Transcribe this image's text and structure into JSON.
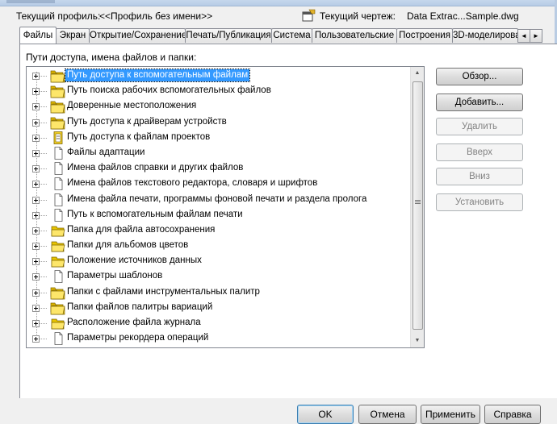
{
  "header": {
    "profile_label": "Текущий профиль:",
    "profile_value": "<<Профиль без имени>>",
    "drawing_label": "Текущий чертеж:",
    "drawing_value": "Data Extrac...Sample.dwg"
  },
  "tabs": [
    {
      "label": "Файлы",
      "active": true
    },
    {
      "label": "Экран"
    },
    {
      "label": "Открытие/Сохранение"
    },
    {
      "label": "Печать/Публикация"
    },
    {
      "label": "Система"
    },
    {
      "label": "Пользовательские"
    },
    {
      "label": "Построения"
    },
    {
      "label": "3D-моделирова"
    }
  ],
  "tab_scroll": {
    "left": "◄",
    "right": "►"
  },
  "paths_label": "Пути доступа, имена файлов и папки:",
  "tree": [
    {
      "label": "Путь доступа к вспомогательным файлам",
      "icon": "folder-stack-icon",
      "selected": true
    },
    {
      "label": "Путь поиска рабочих вспомогательных файлов",
      "icon": "folder-stack-icon"
    },
    {
      "label": "Доверенные местоположения",
      "icon": "folder-stack-icon"
    },
    {
      "label": "Путь доступа к драйверам устройств",
      "icon": "folder-stack-icon"
    },
    {
      "label": "Путь доступа к файлам проектов",
      "icon": "project-file-icon"
    },
    {
      "label": "Файлы адаптации",
      "icon": "file-icon"
    },
    {
      "label": "Имена файлов справки и других файлов",
      "icon": "file-icon"
    },
    {
      "label": "Имена файлов текстового редактора, словаря и шрифтов",
      "icon": "file-icon"
    },
    {
      "label": "Имена файла печати, программы фоновой печати и раздела пролога",
      "icon": "file-icon"
    },
    {
      "label": "Путь к вспомогательным файлам печати",
      "icon": "file-icon"
    },
    {
      "label": "Папка для файла автосохранения",
      "icon": "folder-icon"
    },
    {
      "label": "Папки для альбомов цветов",
      "icon": "folder-icon"
    },
    {
      "label": "Положение источников данных",
      "icon": "folder-icon"
    },
    {
      "label": "Параметры шаблонов",
      "icon": "file-icon"
    },
    {
      "label": "Папки с файлами инструментальных палитр",
      "icon": "folder-stack-icon"
    },
    {
      "label": "Папки файлов палитры вариаций",
      "icon": "folder-stack-icon"
    },
    {
      "label": "Расположение файла журнала",
      "icon": "folder-icon"
    },
    {
      "label": "Параметры рекордера операций",
      "icon": "file-icon"
    }
  ],
  "side_buttons": [
    {
      "label": "Обзор...",
      "enabled": true
    },
    {
      "label": "Добавить...",
      "enabled": true
    },
    {
      "label": "Удалить",
      "enabled": false
    },
    {
      "label": "Вверх",
      "enabled": false
    },
    {
      "label": "Вниз",
      "enabled": false
    },
    {
      "label": "Установить",
      "enabled": false
    }
  ],
  "bottom_buttons": {
    "ok": "OK",
    "cancel": "Отмена",
    "apply": "Применить",
    "help": "Справка"
  },
  "colors": {
    "selection": "#3399ff",
    "folder": "#f5d328"
  }
}
